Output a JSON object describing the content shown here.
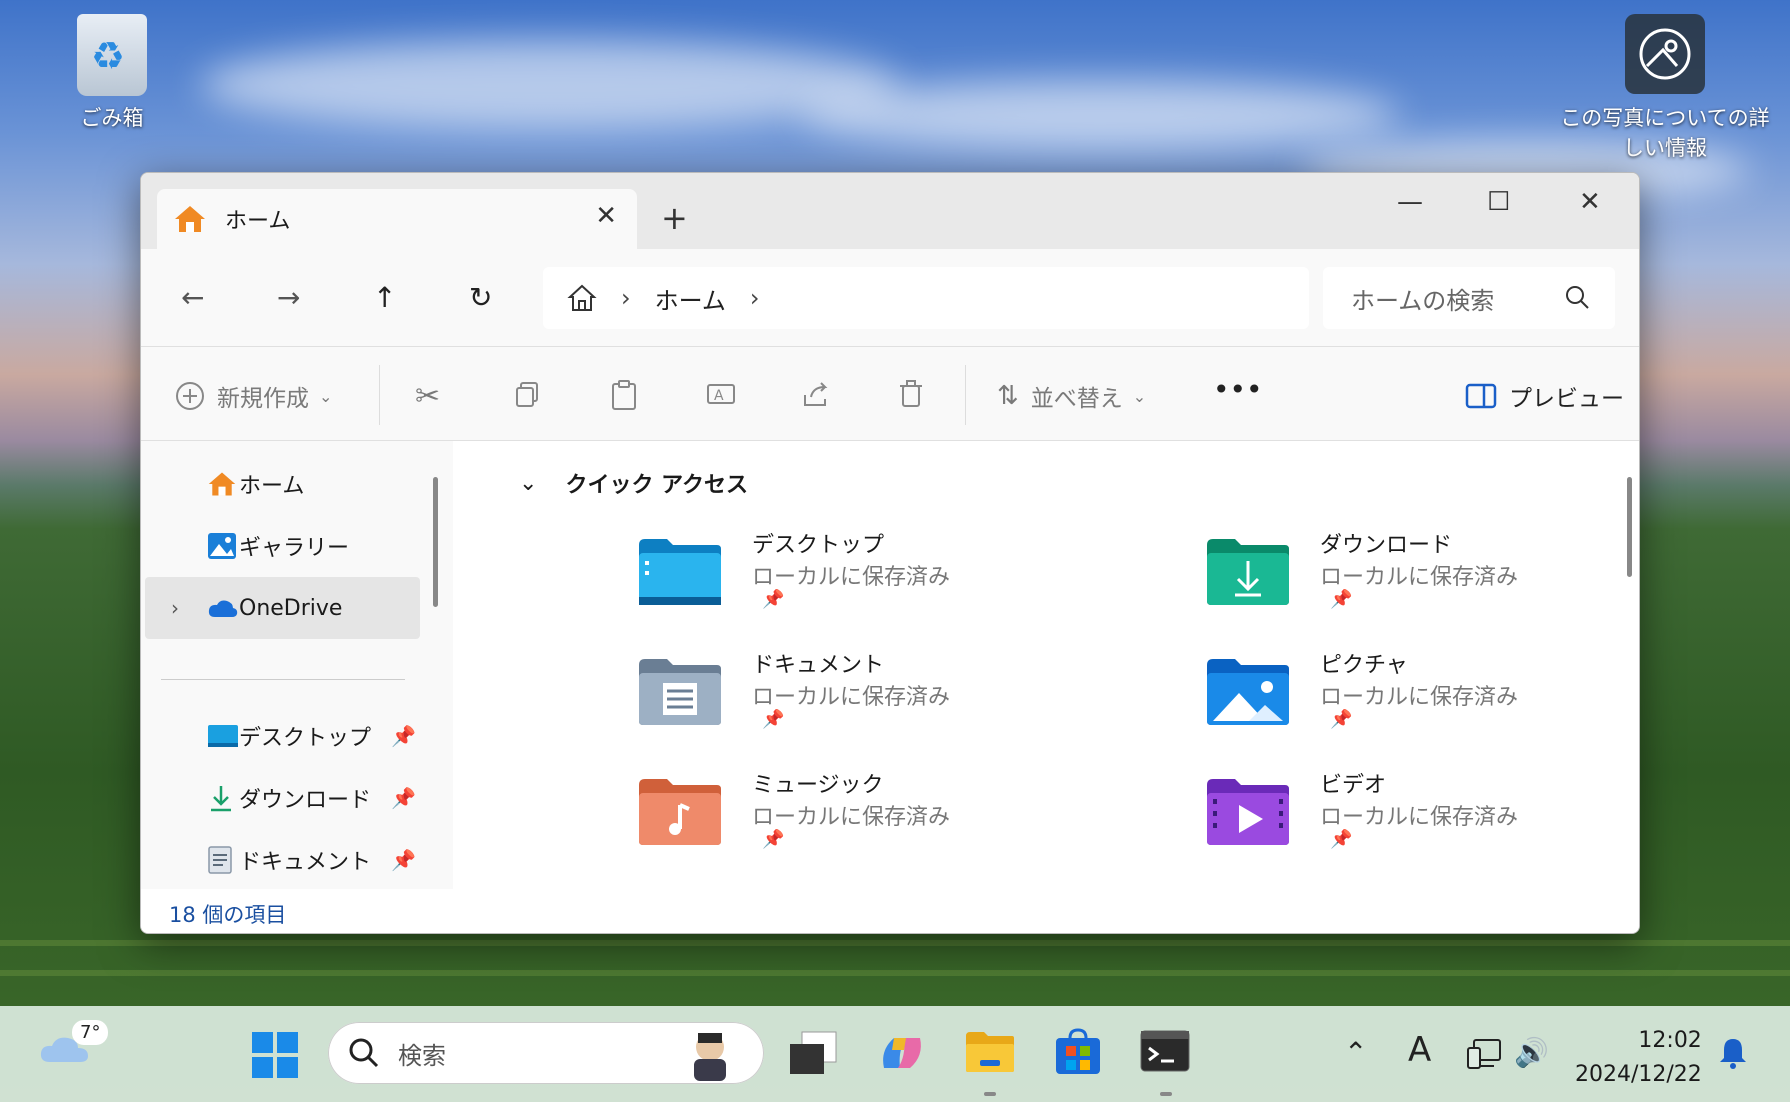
{
  "desktop": {
    "recycle_bin": "ごみ箱",
    "photo_info_line1": "この写真についての詳",
    "photo_info_line2": "しい情報"
  },
  "window": {
    "tab_title": "ホーム",
    "address_current": "ホーム",
    "search_placeholder": "ホームの検索"
  },
  "commandbar": {
    "new_label": "新規作成",
    "sort_label": "並べ替え",
    "preview_label": "プレビュー"
  },
  "nav": {
    "items": [
      {
        "label": "ホーム"
      },
      {
        "label": "ギャラリー"
      },
      {
        "label": "OneDrive"
      },
      {
        "label": "デスクトップ"
      },
      {
        "label": "ダウンロード"
      },
      {
        "label": "ドキュメント"
      }
    ]
  },
  "quick_access": {
    "heading": "クイック アクセス",
    "tiles": [
      {
        "name": "デスクトップ",
        "sub": "ローカルに保存済み"
      },
      {
        "name": "ダウンロード",
        "sub": "ローカルに保存済み"
      },
      {
        "name": "ドキュメント",
        "sub": "ローカルに保存済み"
      },
      {
        "name": "ピクチャ",
        "sub": "ローカルに保存済み"
      },
      {
        "name": "ミュージック",
        "sub": "ローカルに保存済み"
      },
      {
        "name": "ビデオ",
        "sub": "ローカルに保存済み"
      }
    ]
  },
  "status": {
    "items_count": "18 個の項目"
  },
  "taskbar": {
    "weather_temp": "7°",
    "search_label": "検索",
    "ime": "A",
    "time": "12:02",
    "date": "2024/12/22"
  }
}
